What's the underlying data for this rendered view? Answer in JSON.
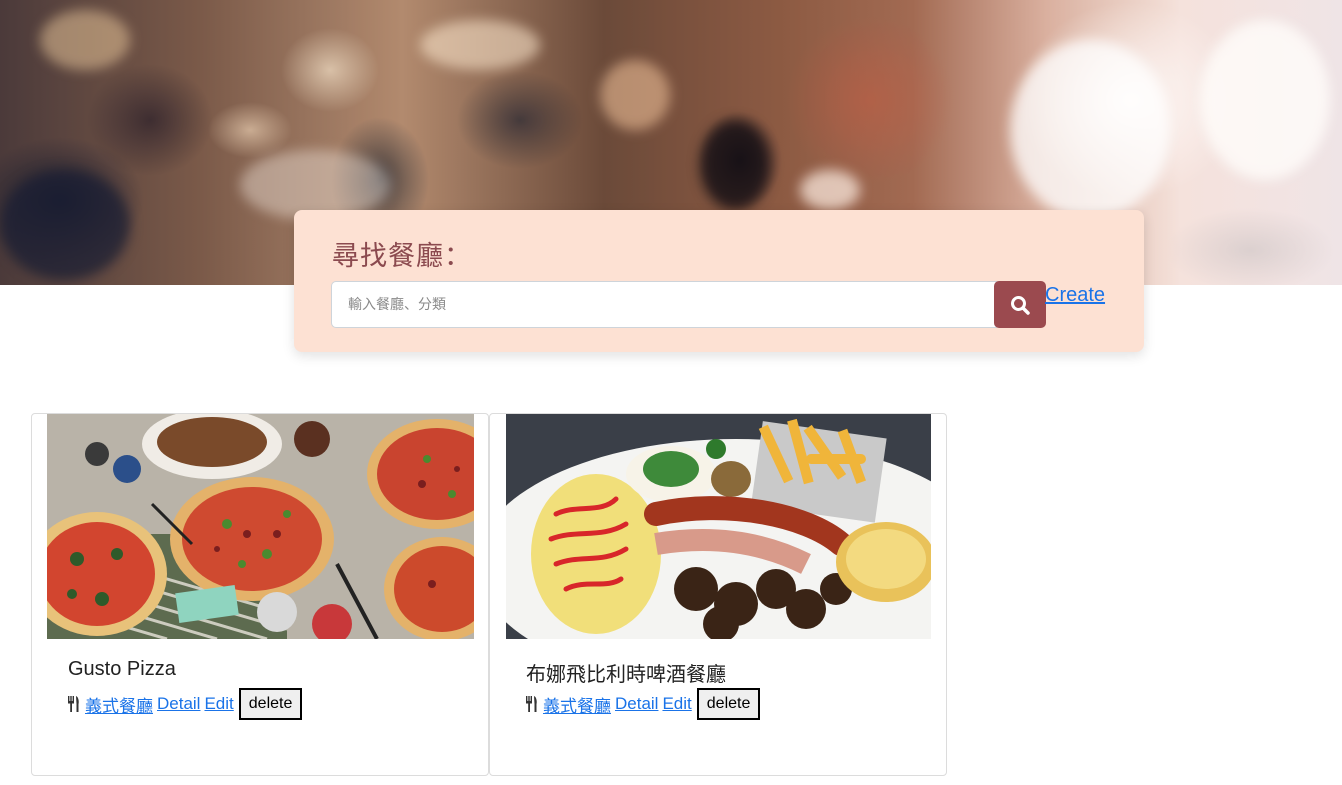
{
  "search": {
    "title": "尋找餐廳：",
    "placeholder": "輸入餐廳、分類",
    "button_icon": "search-icon",
    "create_label": "Create"
  },
  "colors": {
    "panel_bg": "#fde1d3",
    "title_color": "#8b4a4f",
    "button_bg": "#9b4a4f",
    "link_color": "#1a73e8"
  },
  "restaurants": [
    {
      "name": "Gusto Pizza",
      "category": "義式餐廳",
      "detail_label": "Detail",
      "edit_label": "Edit",
      "delete_label": "delete",
      "image": "pizza-photo"
    },
    {
      "name": "布娜飛比利時啤酒餐廳",
      "category": "義式餐廳",
      "detail_label": "Detail",
      "edit_label": "Edit",
      "delete_label": "delete",
      "image": "breakfast-platter-photo"
    }
  ]
}
